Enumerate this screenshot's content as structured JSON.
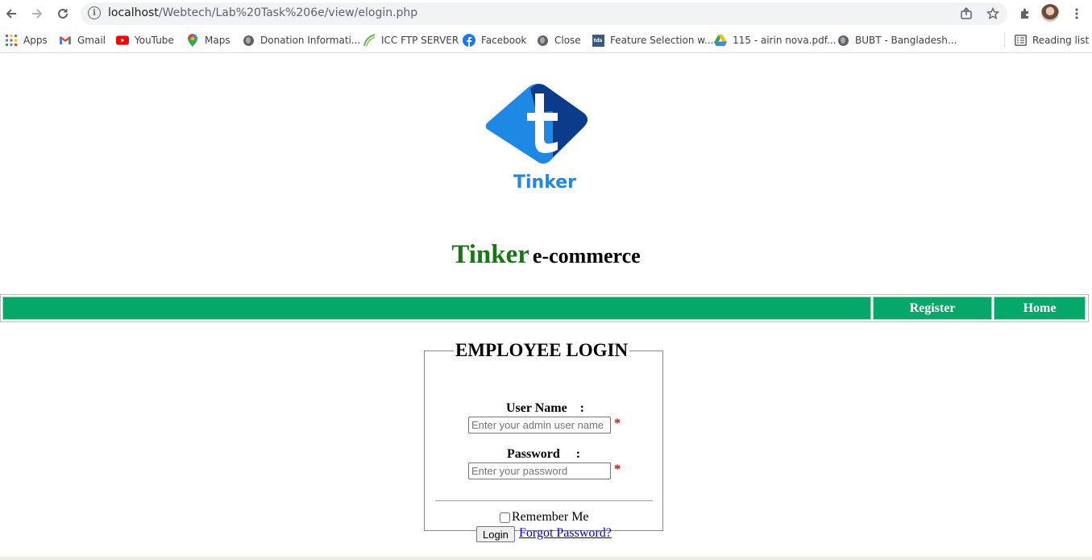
{
  "browser": {
    "url_host": "localhost",
    "url_path": "/Webtech/Lab%20Task%206e/view/elogin.php",
    "bookmarks": [
      {
        "label": "Apps",
        "icon": "apps-grid-icon"
      },
      {
        "label": "Gmail",
        "icon": "gmail-icon"
      },
      {
        "label": "YouTube",
        "icon": "youtube-icon"
      },
      {
        "label": "Maps",
        "icon": "maps-pin-icon"
      },
      {
        "label": "Donation Informati...",
        "icon": "globe-icon"
      },
      {
        "label": "ICC FTP SERVER",
        "icon": "icc-icon"
      },
      {
        "label": "Facebook",
        "icon": "facebook-icon"
      },
      {
        "label": "Close",
        "icon": "globe-icon"
      },
      {
        "label": "Feature Selection w...",
        "icon": "tds-icon"
      },
      {
        "label": "115 - airin nova.pdf...",
        "icon": "google-drive-icon"
      },
      {
        "label": "BUBT - Bangladesh...",
        "icon": "globe-icon"
      }
    ],
    "tds_badge": "tds",
    "reading_list": "Reading list"
  },
  "page": {
    "logo_text": "Tinker",
    "brand": "Tinker",
    "brand_suffix": "e-commerce",
    "nav": {
      "register": "Register",
      "home": "Home"
    },
    "login": {
      "legend": "EMPLOYEE LOGIN",
      "username_label": "User Name    :",
      "username_placeholder": "Enter your admin user name",
      "password_label": "Password     :",
      "password_placeholder": "Enter your password",
      "required_mark": "*",
      "remember_label": "Remember Me",
      "login_button": "Login",
      "forgot_link": "Forgot Password?"
    }
  },
  "colors": {
    "nav_green": "#04a96a",
    "brand_green": "#117b11",
    "logo_blue_light": "#1e88e5",
    "logo_blue_dark": "#0d3b8c",
    "link_blue": "#0000ee",
    "required_red": "#e00000"
  }
}
